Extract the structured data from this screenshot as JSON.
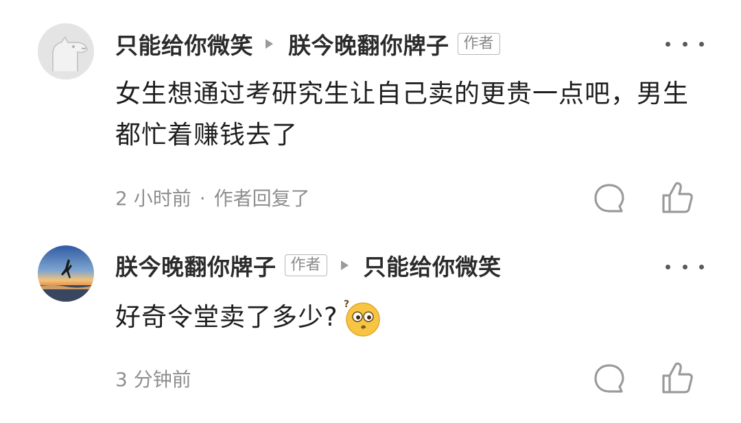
{
  "comments": [
    {
      "avatar_icon": "dog-sketch-avatar",
      "author": "只能给你微笑",
      "reply_to": "朕今晚翻你牌子",
      "reply_to_badge": "作者",
      "text": "女生想通过考研究生让自己卖的更贵一点吧，男生都忙着赚钱去了",
      "time": "2 小时前",
      "separator": "·",
      "status": "作者回复了"
    },
    {
      "avatar_icon": "sunset-beach-avatar",
      "author": "朕今晚翻你牌子",
      "author_badge": "作者",
      "reply_to": "只能给你微笑",
      "text": "好奇令堂卖了多少?",
      "emoji": "thinking-face-emoji",
      "time": "3 分钟前"
    }
  ],
  "colors": {
    "text": "#1e1e1e",
    "meta": "#8e8e8e",
    "icon": "#9a9a9a",
    "emoji": "#f7c443"
  }
}
